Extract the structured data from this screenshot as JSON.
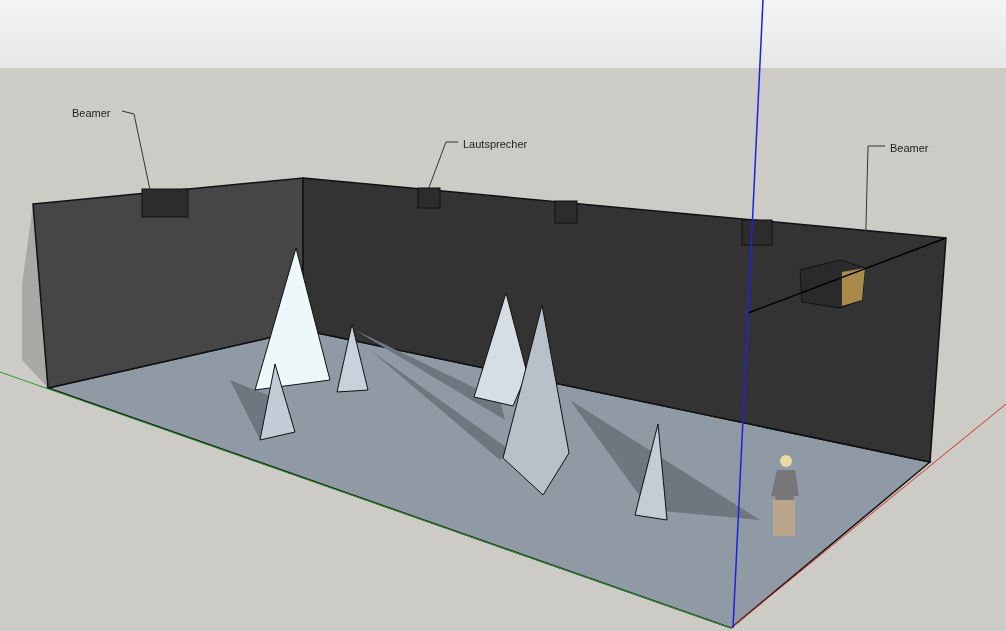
{
  "callouts": [
    {
      "text": "Beamer"
    },
    {
      "text": "Lautsprecher"
    },
    {
      "text": "Beamer"
    }
  ]
}
